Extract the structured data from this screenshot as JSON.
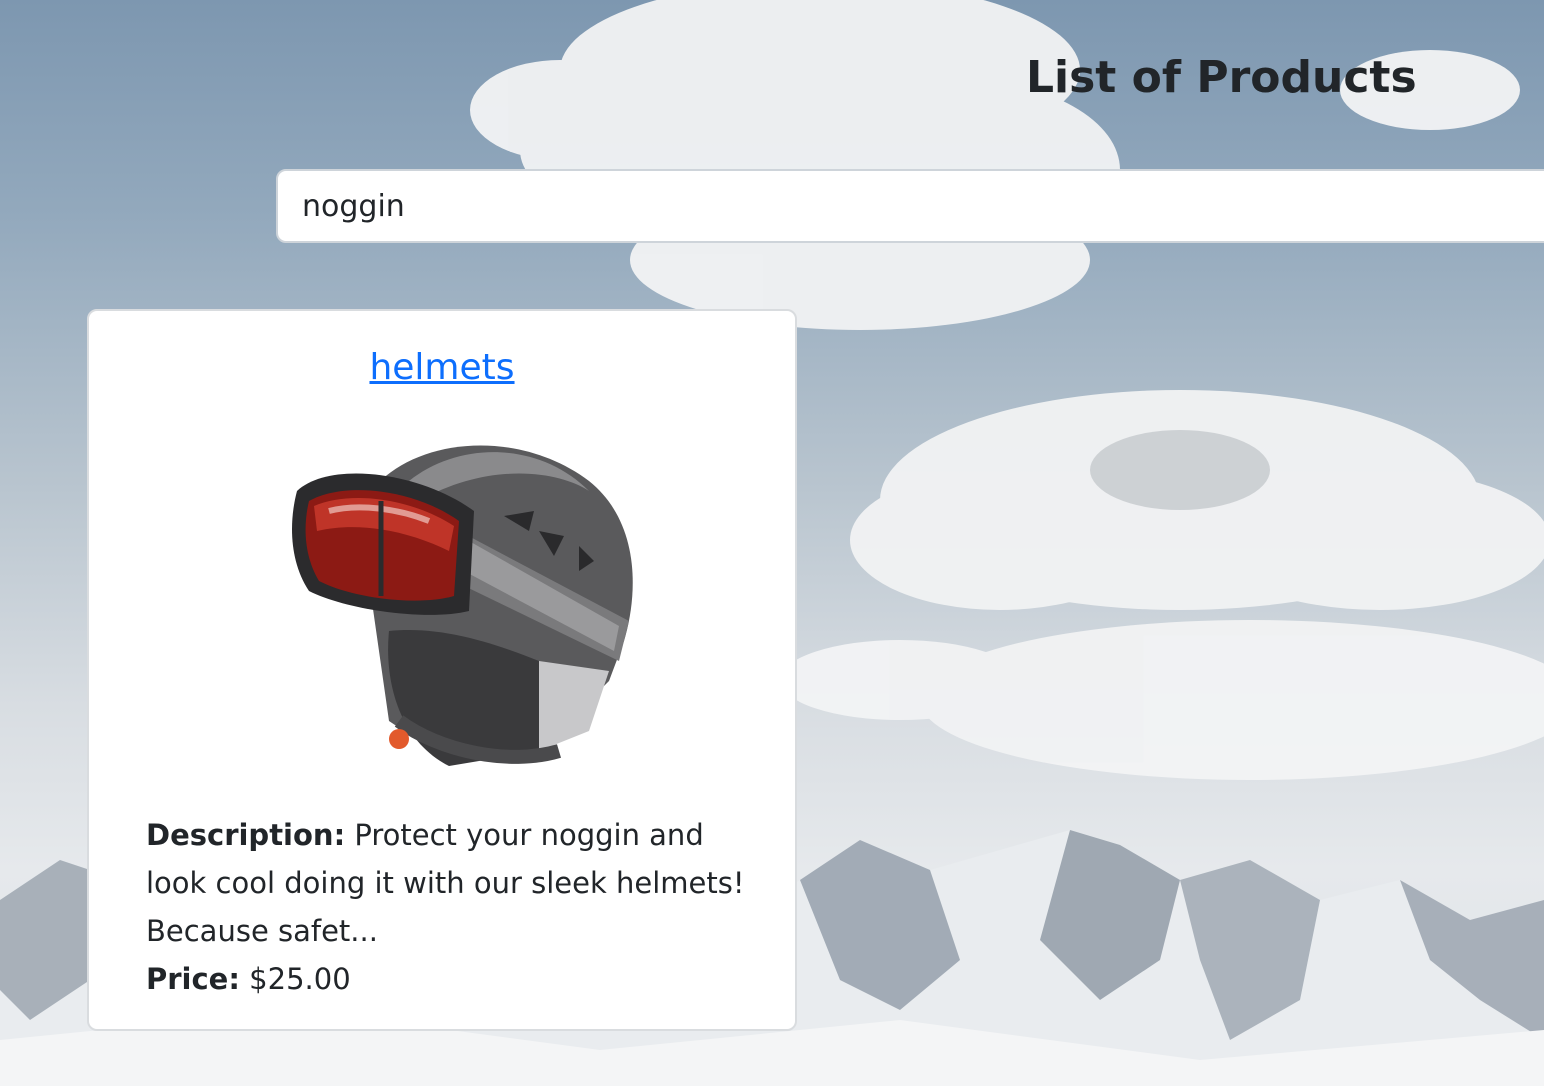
{
  "header": {
    "title": "List of Products"
  },
  "search": {
    "value": "noggin",
    "placeholder": ""
  },
  "products": [
    {
      "name": "helmets",
      "description_label": "Description:",
      "description": "Protect your noggin and look cool doing it with our sleek helmets! Because safet...",
      "price_label": "Price:",
      "price": "$25.00",
      "image_icon": "ski-helmet-with-goggles"
    }
  ],
  "colors": {
    "link": "#0d6efd",
    "text": "#212529",
    "card_bg": "#ffffff"
  }
}
